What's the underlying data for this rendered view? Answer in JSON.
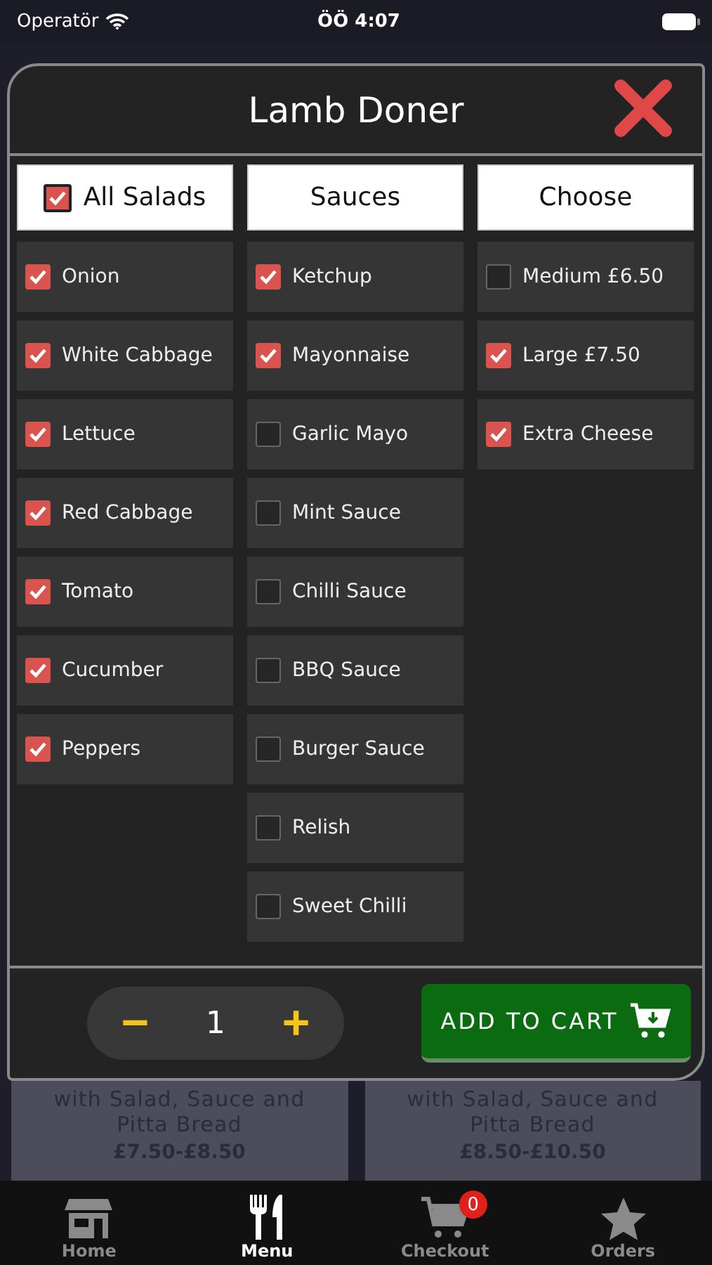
{
  "status_bar": {
    "carrier": "Operatör",
    "time": "ÖÖ 4:07"
  },
  "modal": {
    "title": "Lamb Doner",
    "columns": [
      {
        "header": "All Salads",
        "header_checked": true,
        "items": [
          {
            "label": "Onion",
            "checked": true
          },
          {
            "label": "White Cabbage",
            "checked": true
          },
          {
            "label": "Lettuce",
            "checked": true
          },
          {
            "label": "Red Cabbage",
            "checked": true
          },
          {
            "label": "Tomato",
            "checked": true
          },
          {
            "label": "Cucumber",
            "checked": true
          },
          {
            "label": "Peppers",
            "checked": true
          }
        ]
      },
      {
        "header": "Sauces",
        "items": [
          {
            "label": "Ketchup",
            "checked": true
          },
          {
            "label": "Mayonnaise",
            "checked": true
          },
          {
            "label": "Garlic Mayo",
            "checked": false
          },
          {
            "label": "Mint Sauce",
            "checked": false
          },
          {
            "label": "Chilli Sauce",
            "checked": false
          },
          {
            "label": "BBQ Sauce",
            "checked": false
          },
          {
            "label": "Burger Sauce",
            "checked": false
          },
          {
            "label": "Relish",
            "checked": false
          },
          {
            "label": "Sweet Chilli",
            "checked": false
          }
        ]
      },
      {
        "header": "Choose",
        "items": [
          {
            "label": "Medium £6.50",
            "checked": false
          },
          {
            "label": "Large £7.50",
            "checked": true
          },
          {
            "label": "Extra Cheese",
            "checked": true
          }
        ]
      }
    ],
    "quantity": {
      "minus": "−",
      "value": "1",
      "plus": "+"
    },
    "add_to_cart": "ADD TO CART"
  },
  "cards": [
    {
      "description": "with Salad, Sauce and Pitta Bread",
      "price": "£7.50-£8.50"
    },
    {
      "description": "with Salad, Sauce and Pitta Bread",
      "price": "£8.50-£10.50"
    }
  ],
  "tab_bar": [
    {
      "label": "Home",
      "kind": "store",
      "selected": false
    },
    {
      "label": "Menu",
      "kind": "cutlery",
      "selected": true
    },
    {
      "label": "Checkout",
      "kind": "cart",
      "selected": false,
      "badge": "0"
    },
    {
      "label": "Orders",
      "kind": "star",
      "selected": false
    }
  ]
}
